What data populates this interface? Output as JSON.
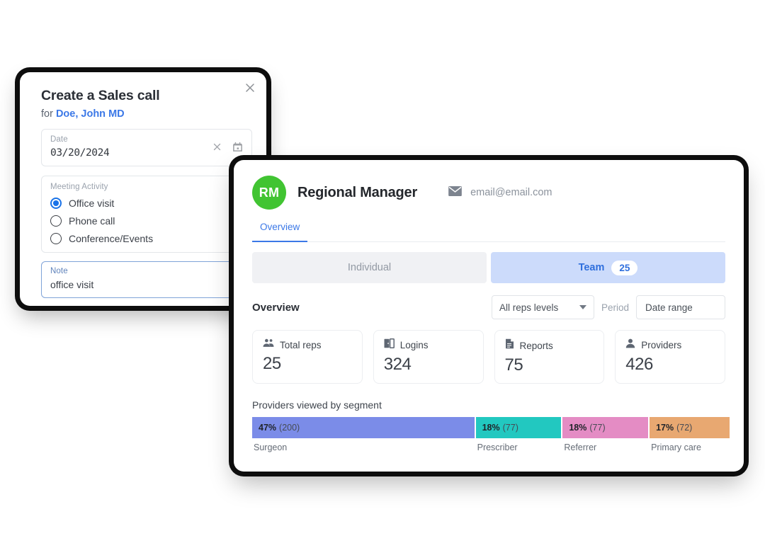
{
  "dialog": {
    "title_prefix": "Create a ",
    "title_strong": "Sales call",
    "for_prefix": "for ",
    "for_name": "Doe, John MD",
    "close_icon": "close-icon",
    "date_field": {
      "label": "Date",
      "value": "03/20/2024",
      "clear_icon": "clear-icon",
      "calendar_icon": "calendar-icon"
    },
    "activity_field": {
      "label": "Meeting Activity",
      "chevron_icon": "chevron-right-icon",
      "options": [
        {
          "label": "Office visit",
          "selected": true
        },
        {
          "label": "Phone call",
          "selected": false
        },
        {
          "label": "Conference/Events",
          "selected": false
        }
      ]
    },
    "note_field": {
      "label": "Note",
      "value": "office visit"
    }
  },
  "dashboard": {
    "avatar_initials": "RM",
    "avatar_color": "#41c432",
    "title": "Regional Manager",
    "email_icon": "envelope-icon",
    "email": "email@email.com",
    "tabs": [
      {
        "label": "Overview",
        "active": true
      }
    ],
    "segment_tabs": [
      {
        "label": "Individual",
        "active": false,
        "count": ""
      },
      {
        "label": "Team",
        "active": true,
        "count": "25"
      }
    ],
    "overview_label": "Overview",
    "controls": {
      "reps_level_value": "All reps levels",
      "caret_icon": "chevron-down-icon",
      "period_label": "Period",
      "date_range_value": "Date range"
    },
    "stats": [
      {
        "label": "Total reps",
        "value": "25",
        "icon": "people-group-icon"
      },
      {
        "label": "Logins",
        "value": "324",
        "icon": "login-door-icon"
      },
      {
        "label": "Reports",
        "value": "75",
        "icon": "document-icon"
      },
      {
        "label": "Providers",
        "value": "426",
        "icon": "person-icon"
      }
    ]
  },
  "chart_data": {
    "type": "bar",
    "orientation": "horizontal-stacked",
    "title": "Providers viewed by segment",
    "categories": [
      "Surgeon",
      "Prescriber",
      "Referrer",
      "Primary care"
    ],
    "values": [
      200,
      77,
      77,
      72
    ],
    "percents": [
      "47%",
      "18%",
      "18%",
      "17%"
    ],
    "counts": [
      "(200)",
      "(77)",
      "(77)",
      "(72)"
    ],
    "colors": [
      "#7b8ce8",
      "#22c8c0",
      "#e48cc4",
      "#e8a871"
    ],
    "total": 426,
    "xlabel": "",
    "ylabel": "",
    "grid": false,
    "legend": "below-bar"
  }
}
